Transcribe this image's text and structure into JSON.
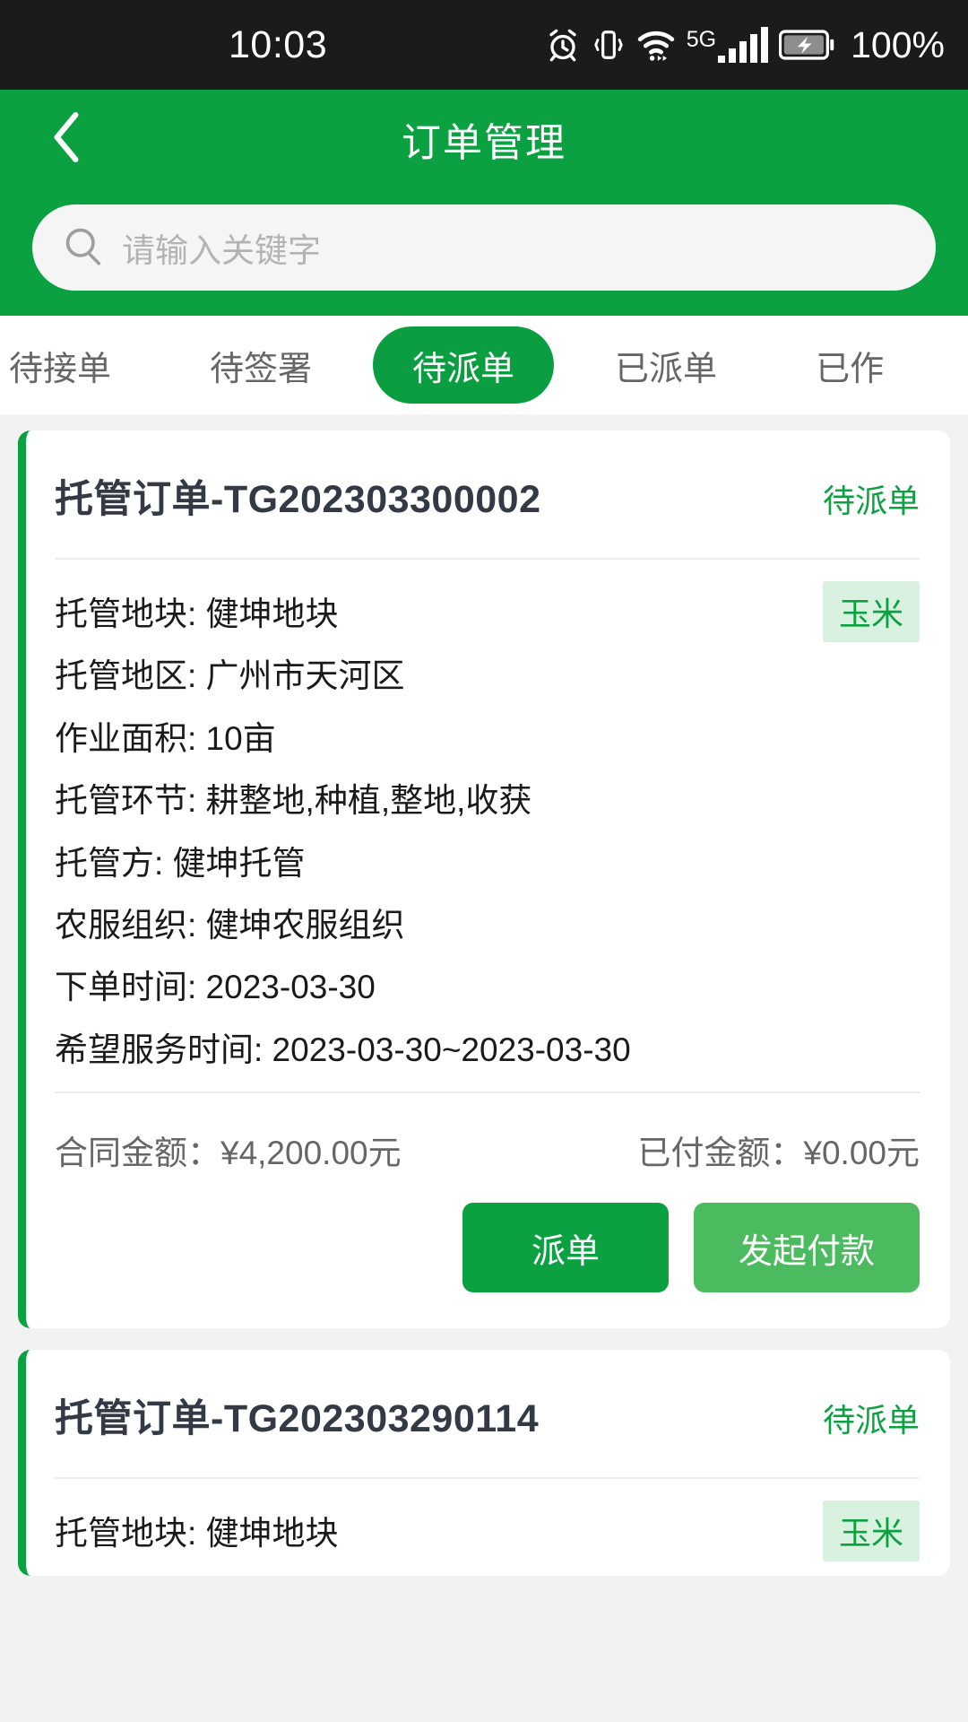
{
  "status_bar": {
    "time": "10:03",
    "battery_percent": "100%",
    "network_label": "5G",
    "icons": [
      "alarm-icon",
      "vibrate-icon",
      "wifi-icon",
      "signal-bars-icon",
      "battery-charging-icon"
    ]
  },
  "header": {
    "title": "订单管理",
    "back_icon": "chevron-left-icon",
    "search": {
      "placeholder": "请输入关键字",
      "value": "",
      "icon": "search-icon"
    },
    "background_color": "#0ba140"
  },
  "tabs": {
    "items": [
      {
        "label": "待接单",
        "active": false
      },
      {
        "label": "待签署",
        "active": false
      },
      {
        "label": "待派单",
        "active": true
      },
      {
        "label": "已派单",
        "active": false
      },
      {
        "label": "已作",
        "active": false
      }
    ],
    "active_color": "#0b9e40",
    "inactive_color": "#666666"
  },
  "orders": [
    {
      "title": "托管订单-TG202303300002",
      "status": "待派单",
      "crop_tag": "玉米",
      "details": [
        "托管地块: 健坤地块",
        "托管地区: 广州市天河区",
        "作业面积: 10亩",
        "托管环节: 耕整地,种植,整地,收获",
        "托管方: 健坤托管",
        "农服组织: 健坤农服组织",
        "下单时间: 2023-03-30",
        "希望服务时间: 2023-03-30~2023-03-30"
      ],
      "contract_label": "合同金额：",
      "contract_amount": "¥4,200.00元",
      "paid_label": "已付金额：",
      "paid_amount": "¥0.00元",
      "buttons": [
        {
          "label": "派单",
          "style": "primary"
        },
        {
          "label": "发起付款",
          "style": "secondary"
        }
      ]
    },
    {
      "title": "托管订单-TG202303290114",
      "status": "待派单",
      "crop_tag": "玉米",
      "details": [
        "托管地块: 健坤地块"
      ],
      "contract_label": "",
      "contract_amount": "",
      "paid_label": "",
      "paid_amount": "",
      "buttons": []
    }
  ],
  "colors": {
    "brand_green": "#0ba140",
    "button_secondary": "#4cbb5f",
    "tag_background": "#d9f2e0",
    "page_background": "#f2f2f2"
  }
}
